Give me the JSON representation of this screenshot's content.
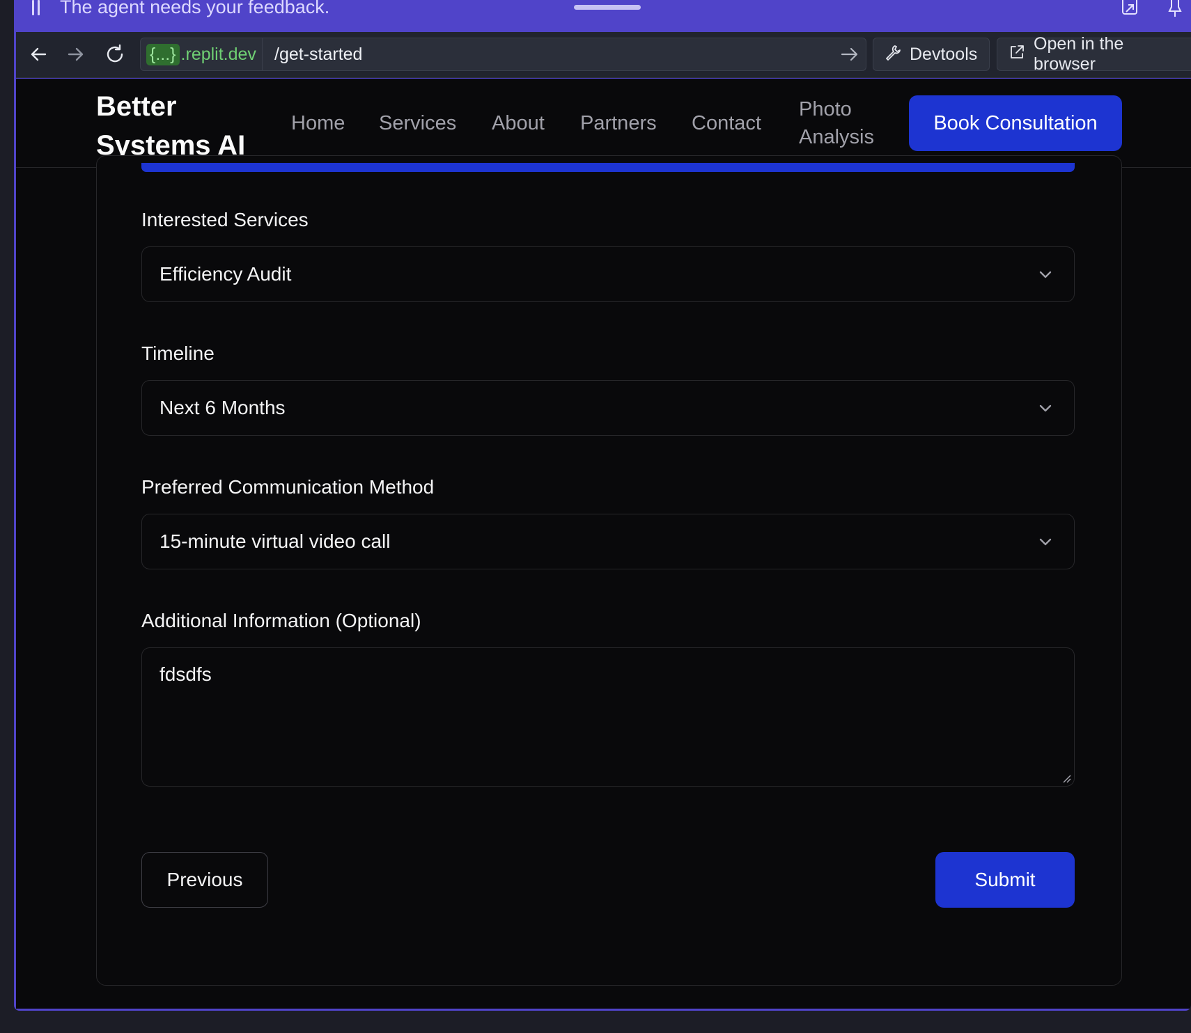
{
  "banner": {
    "message": "The agent needs your feedback."
  },
  "browser": {
    "url_domain_brace": "{...}",
    "url_domain": ".replit.dev",
    "url_path": "/get-started",
    "devtools_label": "Devtools",
    "open_browser_label": "Open in the browser"
  },
  "header": {
    "logo_line1": "Better",
    "logo_line2": "Systems AI",
    "nav": [
      {
        "label": "Home"
      },
      {
        "label": "Services"
      },
      {
        "label": "About"
      },
      {
        "label": "Partners"
      },
      {
        "label": "Contact"
      },
      {
        "label_line1": "Photo",
        "label_line2": "Analysis"
      }
    ],
    "cta_label": "Book Consultation"
  },
  "form": {
    "progress": 1.0,
    "services_label": "Interested Services",
    "services_value": "Efficiency Audit",
    "timeline_label": "Timeline",
    "timeline_value": "Next 6 Months",
    "communication_label": "Preferred Communication Method",
    "communication_value": "15-minute virtual video call",
    "additional_label": "Additional Information (Optional)",
    "additional_value": "fdsdfs",
    "previous_label": "Previous",
    "submit_label": "Submit"
  },
  "colors": {
    "accent": "#1d34d1",
    "banner": "#5044c9",
    "background": "#09090b"
  }
}
